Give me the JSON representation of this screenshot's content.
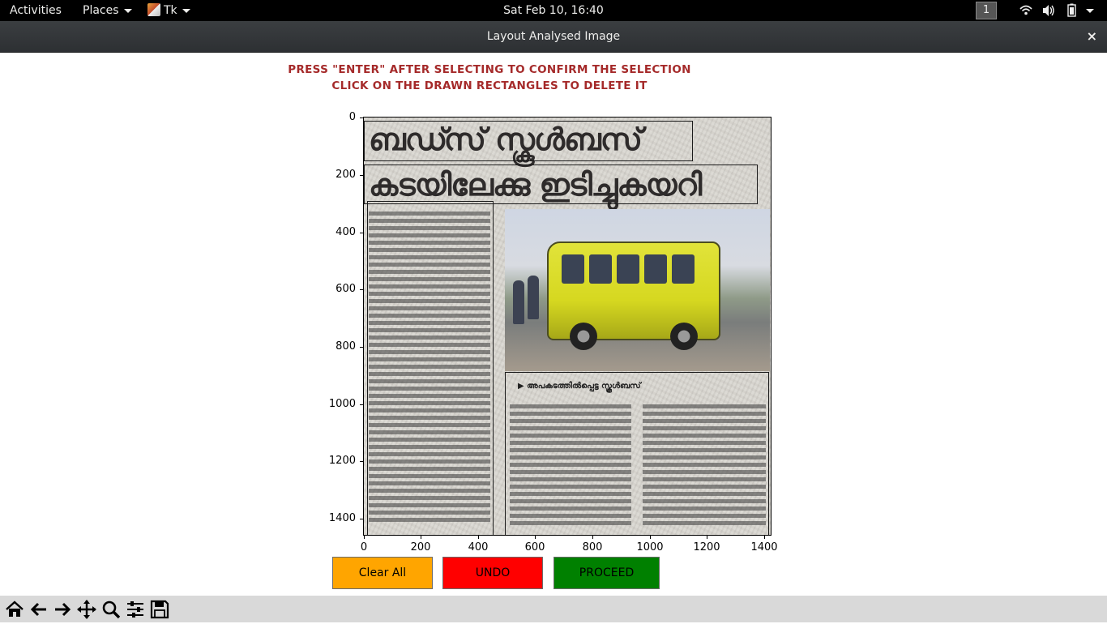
{
  "topbar": {
    "activities": "Activities",
    "places": "Places",
    "app_name": "Tk",
    "clock": "Sat Feb 10, 16:40",
    "workspace": "1"
  },
  "window": {
    "title": "Layout Analysed Image",
    "close_glyph": "×"
  },
  "instructions": {
    "line1": "PRESS \"ENTER\" AFTER SELECTING TO CONFIRM THE SELECTION",
    "line2": "CLICK ON THE DRAWN RECTANGLES TO DELETE IT"
  },
  "axes": {
    "y_ticks": [
      "0",
      "200",
      "400",
      "600",
      "800",
      "1000",
      "1200",
      "1400"
    ],
    "x_ticks": [
      "0",
      "200",
      "400",
      "600",
      "800",
      "1000",
      "1200",
      "1400"
    ]
  },
  "newspaper": {
    "headline1": "ബഡ്സ് സ്കൂൾബസ്",
    "headline2": "കടയിലേക്കു ഇടിച്ചുകയറി",
    "photo_caption": "അപകടത്തിൽപ്പെട്ട സ്കൂൾബസ്"
  },
  "buttons": {
    "clear_all": "Clear All",
    "undo": "UNDO",
    "proceed": "PROCEED"
  },
  "colors": {
    "instruction_text": "#a52a2a",
    "clear_all_bg": "#ffa500",
    "undo_bg": "#ff0000",
    "proceed_bg": "#008000"
  },
  "toolbar": {
    "tools": [
      "home-icon",
      "back-arrow-icon",
      "forward-arrow-icon",
      "pan-move-icon",
      "zoom-icon",
      "configure-subplots-icon",
      "save-icon"
    ]
  }
}
